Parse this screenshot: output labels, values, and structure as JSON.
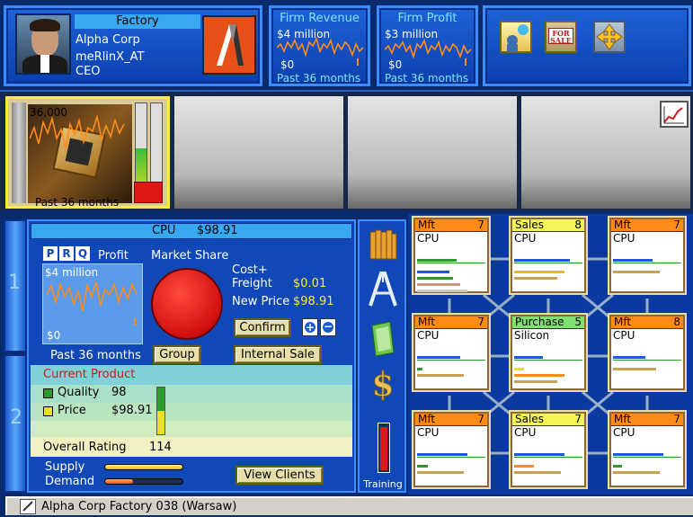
{
  "header": {
    "facility_type": "Factory",
    "company": "Alpha Corp",
    "player_name": "meRlinX_AT",
    "player_title": "CEO"
  },
  "revenue_panel": {
    "title": "Firm Revenue",
    "top_label": "$4 million",
    "bottom_label": "$0",
    "period": "Past 36 months"
  },
  "profit_panel": {
    "title": "Firm Profit",
    "top_label": "$3 million",
    "bottom_label": "$0",
    "period": "Past 36 months"
  },
  "toolbar": {
    "icons": [
      "consult-icon",
      "for-sale-icon",
      "move-icon"
    ],
    "sale_sign_text": "FOR SALE"
  },
  "product_strip": {
    "slot1_value": "36,000",
    "slot1_period": "Past 36 months"
  },
  "detail": {
    "product_name": "CPU",
    "product_price": "$98.91",
    "prq": [
      "P",
      "R",
      "Q"
    ],
    "profit_label": "Profit",
    "profit_top": "$4 million",
    "profit_bottom": "$0",
    "profit_period": "Past 36 months",
    "market_share_label": "Market Share",
    "cost_freight_label_1": "Cost+",
    "cost_freight_label_2": "Freight",
    "cost_freight_value": "$0.01",
    "new_price_label": "New Price",
    "new_price_value": "$98.91",
    "confirm_label": "Confirm",
    "group_label": "Group",
    "internal_sale_label": "Internal Sale",
    "current_product_label": "Current Product",
    "quality_label": "Quality",
    "quality_value": "98",
    "price_label": "Price",
    "price_value": "$98.91",
    "overall_rating_label": "Overall Rating",
    "overall_rating_value": "114",
    "supply_label": "Supply",
    "demand_label": "Demand",
    "view_clients_label": "View Clients",
    "side_tab_1": "1",
    "side_tab_2": "2"
  },
  "side_toolbar": {
    "training_label": "Training"
  },
  "units": [
    {
      "type": "Mft",
      "level": "7",
      "product": "CPU",
      "color": "#ff8c1a"
    },
    {
      "type": "Sales",
      "level": "8",
      "product": "CPU",
      "color": "#f5f55a"
    },
    {
      "type": "Mft",
      "level": "7",
      "product": "CPU",
      "color": "#ff8c1a"
    },
    {
      "type": "Mft",
      "level": "7",
      "product": "CPU",
      "color": "#ff8c1a"
    },
    {
      "type": "Purchase",
      "level": "5",
      "product": "Silicon",
      "color": "#7ee06e"
    },
    {
      "type": "Mft",
      "level": "8",
      "product": "CPU",
      "color": "#ff8c1a"
    },
    {
      "type": "Mft",
      "level": "7",
      "product": "CPU",
      "color": "#ff8c1a"
    },
    {
      "type": "Sales",
      "level": "7",
      "product": "CPU",
      "color": "#f5f55a"
    },
    {
      "type": "Mft",
      "level": "7",
      "product": "CPU",
      "color": "#ff8c1a"
    }
  ],
  "status_bar": {
    "text": "Alpha Corp Factory 038 (Warsaw)"
  }
}
